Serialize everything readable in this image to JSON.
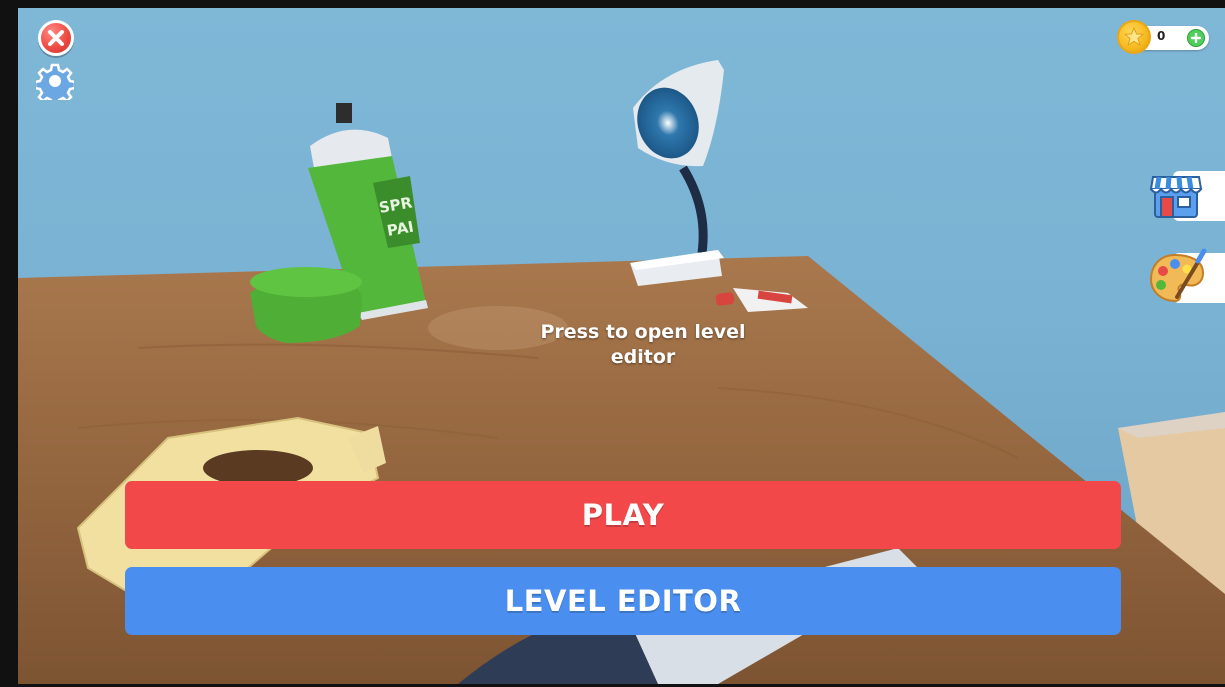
{
  "hud": {
    "close_icon": "close-icon",
    "settings_icon": "gear-icon",
    "coins": {
      "count": "0",
      "coin_icon": "star-coin-icon",
      "add_icon": "plus-icon"
    },
    "side_buttons": {
      "shop_icon": "shop-icon",
      "paint_icon": "paint-palette-icon"
    }
  },
  "hint": {
    "text": "Press to open level editor"
  },
  "buttons": {
    "play_label": "PLAY",
    "level_editor_label": "LEVEL EDITOR"
  },
  "colors": {
    "play": "#f2484a",
    "level_editor": "#4a8fef",
    "close": "#ef4b45",
    "coin": "#f6b91e",
    "add_coin": "#4fcf5b"
  }
}
